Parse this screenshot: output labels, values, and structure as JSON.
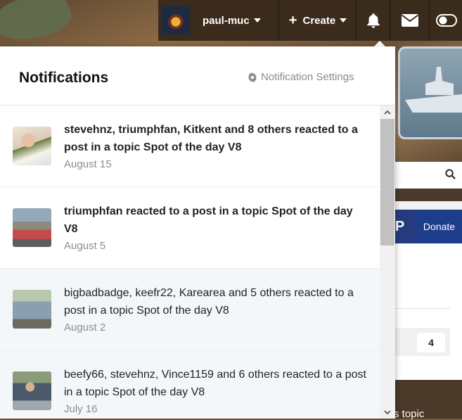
{
  "topbar": {
    "username": "paul-muc",
    "create_label": "Create",
    "icons": {
      "user_caret": "caret-down-icon",
      "create_plus": "plus-icon",
      "notifications": "bell-icon",
      "messages": "envelope-icon",
      "theme": "toggle-icon"
    }
  },
  "background": {
    "donate_label": "Donate",
    "count_value": "4",
    "footer_text": "s topic"
  },
  "notifications": {
    "title": "Notifications",
    "settings_label": "Notification Settings",
    "items": [
      {
        "text": "stevehnz, triumphfan, Kitkent and 8 others reacted to a post in a topic Spot of the day V8",
        "date": "August 15",
        "unread": true
      },
      {
        "text": "triumphfan reacted to a post in a topic Spot of the day V8",
        "date": "August 5",
        "unread": true
      },
      {
        "text": "bigbadbadge, keefr22, Karearea and 5 others reacted to a post in a topic Spot of the day V8",
        "date": "August 2",
        "unread": false
      },
      {
        "text": "beefy66, stevehnz, Vince1159 and 6 others reacted to a post in a topic Spot of the day V8",
        "date": "July 16",
        "unread": false
      }
    ]
  },
  "colors": {
    "topbar_bg": "#3a2b1c",
    "read_row_bg": "#f4f7fa",
    "muted_text": "#8c8c8c",
    "donate_blue": "#1d3c8a"
  }
}
